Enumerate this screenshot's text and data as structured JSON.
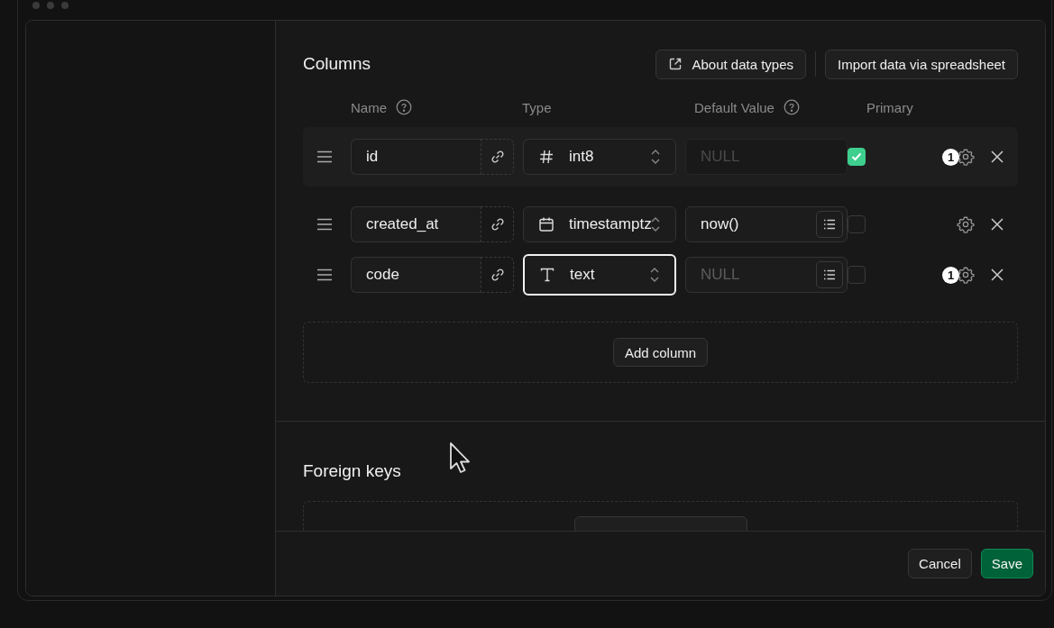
{
  "columns_section": {
    "title": "Columns",
    "buttons": [
      {
        "label": "About data types",
        "kind": "external"
      },
      {
        "label": "Import data via spreadsheet",
        "kind": "plain"
      }
    ],
    "headers": [
      {
        "label": "Name",
        "help": true
      },
      {
        "label": "Type",
        "help": false
      },
      {
        "label": "Default Value",
        "help": true
      },
      {
        "label": "Primary",
        "help": false
      }
    ],
    "rows": [
      {
        "name": "id",
        "type": "int8",
        "kind": "hash",
        "type_focused": false,
        "default_placeholder": "NULL",
        "default_disabled": true,
        "primary": true,
        "badge": "1",
        "selected": true
      },
      {
        "name": "created_at",
        "type": "timestamptz",
        "kind": "calendar",
        "type_focused": false,
        "default_value": "now()",
        "default_disabled": false,
        "primary": false,
        "selected": false
      },
      {
        "name": "code",
        "type": "text",
        "kind": "text",
        "type_focused": true,
        "default_placeholder": "NULL",
        "default_disabled": false,
        "primary": false,
        "badge": "1",
        "selected": false
      }
    ],
    "add_button": "Add column"
  },
  "foreign_keys_section": {
    "title": "Foreign keys"
  },
  "footer": {
    "buttons": [
      {
        "label": "Cancel",
        "kind": "secondary"
      },
      {
        "label": "Save",
        "kind": "primary"
      }
    ]
  }
}
